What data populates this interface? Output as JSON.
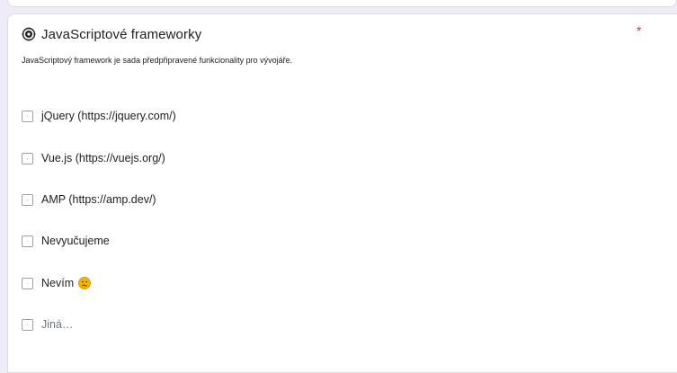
{
  "question": {
    "icon": "brain-gear-icon",
    "title": "JavaScriptové frameworky",
    "required_marker": "*",
    "description": "JavaScriptový framework je sada předpřipravené funkcionality pro vývojáře."
  },
  "options": [
    {
      "label": "jQuery (https://jquery.com/)",
      "checked": false
    },
    {
      "label": "Vue.js (https://vuejs.org/)",
      "checked": false
    },
    {
      "label": "AMP (https://amp.dev/)",
      "checked": false
    },
    {
      "label": "Nevyučujeme",
      "checked": false
    },
    {
      "label": "Nevím",
      "emoji": "confused-face-icon",
      "checked": false
    },
    {
      "label": "Jiná…",
      "checked": false
    }
  ],
  "colors": {
    "background": "#f0ebf8",
    "required": "#d93025",
    "emoji": "#f5b400"
  }
}
